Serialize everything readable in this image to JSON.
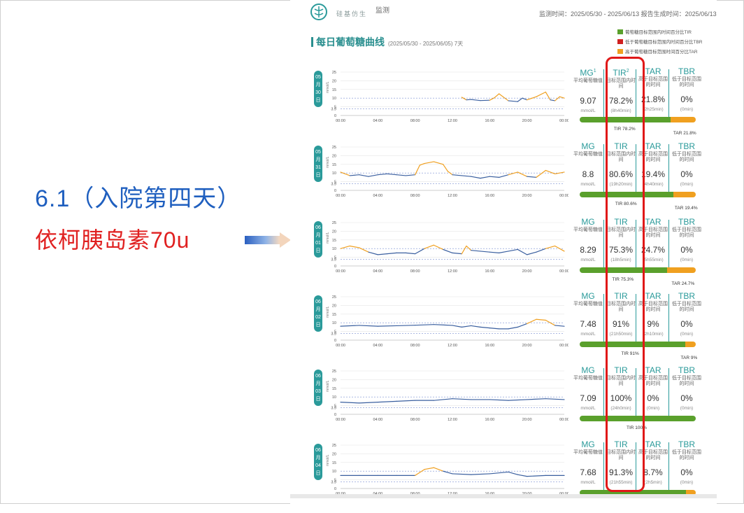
{
  "page": {
    "annotation_date": "6.1（入院第四天）",
    "annotation_drug": "依柯胰岛素70u",
    "logo_text": "硅基仿生",
    "logo_mark": "监测",
    "header_meta": "监测时间：2025/05/30 - 2025/06/13 报告生成时间：2025/06/13",
    "section_title": "每日葡萄糖曲线",
    "section_range": "(2025/05/30 - 2025/06/05) 7天",
    "legend": [
      {
        "label": "葡萄糖目标范围内时间百分比TIR",
        "color": "#5aa02c"
      },
      {
        "label": "低于葡萄糖目标范围内时间百分比TBR",
        "color": "#d02020"
      },
      {
        "label": "高于葡萄糖目标范围时间百分比TAR",
        "color": "#f0a020"
      }
    ],
    "colors": {
      "accent": "#2a9a9a",
      "tir": "#5aa02c",
      "tar": "#f0a020",
      "line": "#3a5f9f",
      "highlight": "#e01818",
      "annotation_blue": "#1f5fbf",
      "annotation_red": "#e02020"
    },
    "icons": {
      "arrow": "right-arrow-icon",
      "logo": "brand-logo-icon"
    }
  },
  "stat_headers": {
    "mg": "MG",
    "tir": "TIR",
    "tar": "TAR",
    "tbr": "TBR",
    "mg_sup": "1",
    "tir_sup": "2",
    "mg_desc": "平均葡萄糖值",
    "tir_desc": "目标范围内时间",
    "tar_desc": "高于目标范围的时间",
    "tbr_desc": "低于目标范围的时间",
    "unit": "mmol/L"
  },
  "chart_data": [
    {
      "type": "line",
      "day_label": [
        "05",
        "月",
        "30",
        "日"
      ],
      "x_ticks": [
        "00:00",
        "04:00",
        "08:00",
        "12:00",
        "16:00",
        "20:00",
        "00:00"
      ],
      "y_ticks": [
        "0",
        "3.9",
        "5",
        "10",
        "15",
        "20",
        "25"
      ],
      "ylabel": "mmol/L",
      "ylim": [
        0,
        25
      ],
      "target": [
        3.9,
        10
      ],
      "series": [
        {
          "x": [
            13,
            13.5,
            14,
            15,
            16,
            16.5,
            17,
            18,
            19,
            19.5,
            20,
            21,
            22,
            22.5,
            23,
            23.5,
            24
          ],
          "y": [
            10.5,
            9.0,
            9.2,
            8.6,
            8.8,
            10.2,
            12.5,
            8.5,
            8.0,
            10.0,
            9.0,
            10.8,
            13.5,
            9.0,
            8.5,
            10.8,
            10.0
          ]
        }
      ],
      "stats": {
        "mg": "9.07",
        "tir": "78.2%",
        "tir_time": "(8h40min)",
        "tar": "21.8%",
        "tar_time": "(2h25min)",
        "tbr": "0%",
        "tbr_time": "(0min)",
        "tir_pct": 78.2,
        "tar_pct": 21.8,
        "tir_label": "TIR 78.2%",
        "tar_label": "TAR 21.8%"
      }
    },
    {
      "type": "line",
      "day_label": [
        "05",
        "月",
        "31",
        "日"
      ],
      "x_ticks": [
        "00:00",
        "04:00",
        "08:00",
        "12:00",
        "16:00",
        "20:00",
        "00:00"
      ],
      "y_ticks": [
        "0",
        "3.9",
        "5",
        "10",
        "15",
        "20",
        "25"
      ],
      "ylabel": "mmol/L",
      "ylim": [
        0,
        25
      ],
      "target": [
        3.9,
        10
      ],
      "series": [
        {
          "x": [
            0,
            1,
            2,
            3,
            4,
            5,
            6,
            7,
            8,
            8.5,
            9,
            10,
            11,
            11.5,
            12,
            13,
            14,
            15,
            16,
            17,
            18,
            19,
            20,
            21,
            22,
            23,
            24
          ],
          "y": [
            10.5,
            8.5,
            9.0,
            8.0,
            9.0,
            9.5,
            9.0,
            8.5,
            9.0,
            14.5,
            15.5,
            16.5,
            15.0,
            11.0,
            9.0,
            8.5,
            8.0,
            7.0,
            8.0,
            7.5,
            9.0,
            10.5,
            8.0,
            7.5,
            11.5,
            9.5,
            10.5
          ]
        }
      ],
      "stats": {
        "mg": "8.8",
        "tir": "80.6%",
        "tir_time": "(19h20min)",
        "tar": "19.4%",
        "tar_time": "(4h40min)",
        "tbr": "0%",
        "tbr_time": "(0min)",
        "tir_pct": 80.6,
        "tar_pct": 19.4,
        "tir_label": "TIR 80.6%",
        "tar_label": "TAR 19.4%"
      }
    },
    {
      "type": "line",
      "day_label": [
        "06",
        "月",
        "01",
        "日"
      ],
      "x_ticks": [
        "00:00",
        "04:00",
        "08:00",
        "12:00",
        "16:00",
        "20:00",
        "00:00"
      ],
      "y_ticks": [
        "0",
        "3.9",
        "5",
        "10",
        "15",
        "20",
        "25"
      ],
      "ylabel": "mmol/L",
      "ylim": [
        0,
        25
      ],
      "target": [
        3.9,
        10
      ],
      "series": [
        {
          "x": [
            0,
            1,
            2,
            3,
            4,
            5,
            6,
            7,
            8,
            9,
            10,
            11,
            12,
            13,
            13.5,
            14,
            15,
            16,
            17,
            18,
            19,
            20,
            21,
            22,
            23,
            24
          ],
          "y": [
            10,
            11.5,
            10.5,
            8.0,
            6.5,
            7.0,
            7.5,
            7.5,
            7.0,
            10.0,
            12.0,
            9.5,
            7.5,
            7.0,
            11.5,
            9.0,
            8.5,
            8.0,
            7.5,
            8.5,
            9.5,
            6.5,
            8.0,
            10.0,
            11.5,
            8.5
          ]
        }
      ],
      "stats": {
        "mg": "8.29",
        "tir": "75.3%",
        "tir_time": "(18h5min)",
        "tar": "24.7%",
        "tar_time": "(5h55min)",
        "tbr": "0%",
        "tbr_time": "(0min)",
        "tir_pct": 75.3,
        "tar_pct": 24.7,
        "tir_label": "TIR 75.3%",
        "tar_label": "TAR 24.7%"
      }
    },
    {
      "type": "line",
      "day_label": [
        "06",
        "月",
        "02",
        "日"
      ],
      "x_ticks": [
        "00:00",
        "04:00",
        "08:00",
        "12:00",
        "16:00",
        "20:00",
        "00:00"
      ],
      "y_ticks": [
        "0",
        "3.9",
        "5",
        "10",
        "15",
        "20",
        "25"
      ],
      "ylabel": "mmol/L",
      "ylim": [
        0,
        25
      ],
      "target": [
        3.9,
        10
      ],
      "series": [
        {
          "x": [
            0,
            2,
            4,
            6,
            8,
            10,
            12,
            13,
            14,
            15,
            16,
            17,
            18,
            19,
            20,
            21,
            22,
            23,
            24
          ],
          "y": [
            8.0,
            8.5,
            8.0,
            8.3,
            8.6,
            9.0,
            8.5,
            7.5,
            8.3,
            7.5,
            7.0,
            6.5,
            6.5,
            7.5,
            9.5,
            12.0,
            11.5,
            8.5,
            8.0
          ]
        }
      ],
      "stats": {
        "mg": "7.48",
        "tir": "91%",
        "tir_time": "(21h50min)",
        "tar": "9%",
        "tar_time": "(2h10min)",
        "tbr": "0%",
        "tbr_time": "(0min)",
        "tir_pct": 91,
        "tar_pct": 9,
        "tir_label": "TIR 91%",
        "tar_label": "TAR 9%"
      }
    },
    {
      "type": "line",
      "day_label": [
        "06",
        "月",
        "03",
        "日"
      ],
      "x_ticks": [
        "00:00",
        "04:00",
        "08:00",
        "12:00",
        "16:00",
        "20:00",
        "00:00"
      ],
      "y_ticks": [
        "0",
        "3.9",
        "5",
        "10",
        "15",
        "20",
        "25"
      ],
      "ylabel": "mmol/L",
      "ylim": [
        0,
        25
      ],
      "target": [
        3.9,
        10
      ],
      "series": [
        {
          "x": [
            0,
            2,
            4,
            6,
            8,
            10,
            12,
            14,
            16,
            18,
            20,
            22,
            24
          ],
          "y": [
            7.0,
            6.5,
            7.0,
            7.5,
            8.0,
            8.0,
            9.0,
            8.5,
            8.5,
            8.0,
            8.5,
            9.0,
            8.5
          ]
        }
      ],
      "stats": {
        "mg": "7.09",
        "tir": "100%",
        "tir_time": "(24h0min)",
        "tar": "0%",
        "tar_time": "(0min)",
        "tbr": "0%",
        "tbr_time": "(0min)",
        "tir_pct": 100,
        "tar_pct": 0,
        "tir_label": "TIR 100%",
        "tar_label": ""
      }
    },
    {
      "type": "line",
      "day_label": [
        "06",
        "月",
        "04",
        "日"
      ],
      "x_ticks": [
        "00:00",
        "04:00",
        "08:00",
        "12:00",
        "16:00",
        "20:00",
        "00:00"
      ],
      "y_ticks": [
        "0",
        "3.9",
        "5",
        "10",
        "15",
        "20",
        "25"
      ],
      "ylabel": "mmol/L",
      "ylim": [
        0,
        25
      ],
      "target": [
        3.9,
        10
      ],
      "series": [
        {
          "x": [
            0,
            2,
            4,
            6,
            8,
            9,
            10,
            11,
            12,
            14,
            16,
            18,
            19,
            20,
            22,
            24
          ],
          "y": [
            7.5,
            7.5,
            7.5,
            7.5,
            7.5,
            11.0,
            12.0,
            10.0,
            8.5,
            8.0,
            8.5,
            9.5,
            8.0,
            7.0,
            7.5,
            7.5
          ]
        }
      ],
      "stats": {
        "mg": "7.68",
        "tir": "91.3%",
        "tir_time": "(21h55min)",
        "tar": "8.7%",
        "tar_time": "(2h5min)",
        "tbr": "0%",
        "tbr_time": "(0min)",
        "tir_pct": 91.3,
        "tar_pct": 8.7,
        "tir_label": "",
        "tar_label": ""
      }
    }
  ]
}
